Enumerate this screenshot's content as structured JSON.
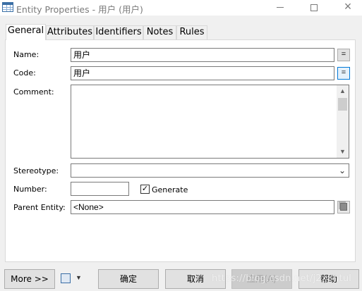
{
  "window": {
    "title": "Entity Properties - 用户 (用户)",
    "app_icon": "table-grid-icon",
    "controls": {
      "minimize": "minimize-icon",
      "maximize": "maximize-icon",
      "close": "×"
    }
  },
  "tabs": [
    {
      "label": "General",
      "active": true
    },
    {
      "label": "Attributes",
      "active": false
    },
    {
      "label": "Identifiers",
      "active": false
    },
    {
      "label": "Notes",
      "active": false
    },
    {
      "label": "Rules",
      "active": false
    }
  ],
  "form": {
    "name": {
      "label": "Name:",
      "value": "用户",
      "button": "="
    },
    "code": {
      "label": "Code:",
      "value": "用户",
      "button": "="
    },
    "comment": {
      "label": "Comment:",
      "value": ""
    },
    "stereotype": {
      "label": "Stereotype:",
      "value": ""
    },
    "number": {
      "label": "Number:",
      "value": ""
    },
    "generate": {
      "label": "Generate",
      "checked": true,
      "mark": "✓"
    },
    "parent_entity": {
      "label": "Parent Entity:",
      "value": "<None>",
      "icon": "properties-icon"
    }
  },
  "footer": {
    "more": "More >>",
    "print_icon": "printer-icon",
    "dropdown_arrow": "▼",
    "ok": "确定",
    "cancel": "取消",
    "apply": "应用(A)",
    "help": "帮助",
    "watermark": "https://blog.csdn.net/j2x3htul"
  },
  "colors": {
    "focus_accent": "#0078d7",
    "dialog_bg": "#f0f0f0",
    "title_text": "#7a7a7a"
  }
}
